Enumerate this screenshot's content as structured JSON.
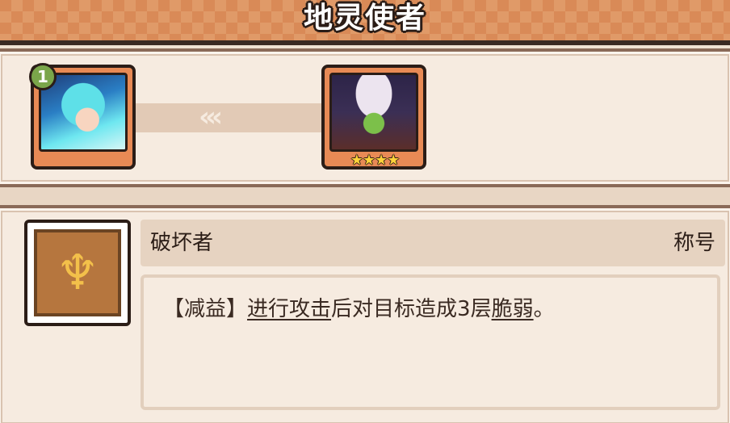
{
  "header": {
    "title": "地灵使者"
  },
  "evolution": {
    "from": {
      "level_badge": "1"
    },
    "arrows": "‹‹‹",
    "to": {
      "stars": "★★★★"
    }
  },
  "skill": {
    "icon": "golden-jellyfish-icon",
    "name": "破坏者",
    "tag": "称号",
    "description": {
      "prefix": "【减益】",
      "kw1": "进行攻击",
      "mid": "后对目标造成3层",
      "kw2": "脆弱",
      "suffix": "。"
    }
  },
  "colors": {
    "header_bg": "#d98a57",
    "panel_bg": "#f6ebe0",
    "badge_green": "#7aa64a",
    "star_yellow": "#ffd23a"
  }
}
